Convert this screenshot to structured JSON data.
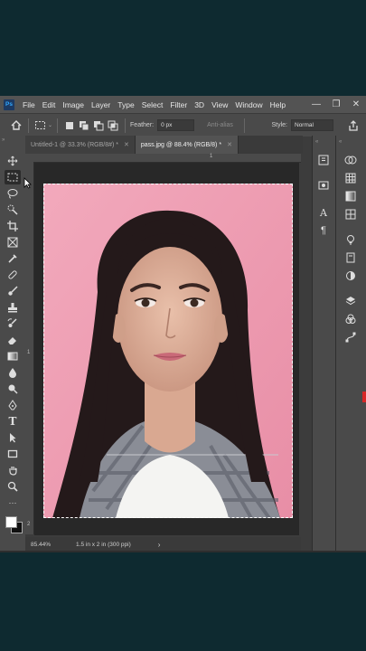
{
  "app": {
    "logo": "Ps",
    "menu": [
      "File",
      "Edit",
      "Image",
      "Layer",
      "Type",
      "Select",
      "Filter",
      "3D",
      "View",
      "Window",
      "Help"
    ],
    "window_controls": [
      "—",
      "❐",
      "✕"
    ]
  },
  "options": {
    "feather_label": "Feather:",
    "feather_value": "0 px",
    "antialias_label": "Anti-alias",
    "style_label": "Style:",
    "style_value": "Normal"
  },
  "tabs": [
    {
      "label": "Untitled-1 @ 33.3% (RGB/8#) *",
      "close": "✕",
      "active": false
    },
    {
      "label": "pass.jpg @ 88.4% (RGB/8) *",
      "close": "✕",
      "active": true
    }
  ],
  "rulers": {
    "top_mark": "1",
    "left_mark_1": "1",
    "left_mark_2": "2"
  },
  "status": {
    "zoom": "85.44%",
    "doc_info": "1.5 in x 2 in (300 ppi)",
    "arrow": "›"
  },
  "colors": {
    "photo_background": "#ef9fb4",
    "accent": "#31a8ff"
  },
  "icons": {
    "tools": [
      "move-icon",
      "marquee-icon",
      "lasso-icon",
      "quick-select-icon",
      "crop-icon",
      "frame-icon",
      "eyedropper-icon",
      "healing-icon",
      "brush-icon",
      "stamp-icon",
      "history-brush-icon",
      "eraser-icon",
      "gradient-icon",
      "blur-icon",
      "dodge-icon",
      "pen-icon",
      "type-icon",
      "path-select-icon",
      "rectangle-icon",
      "hand-icon",
      "zoom-icon",
      "more-icon"
    ]
  }
}
